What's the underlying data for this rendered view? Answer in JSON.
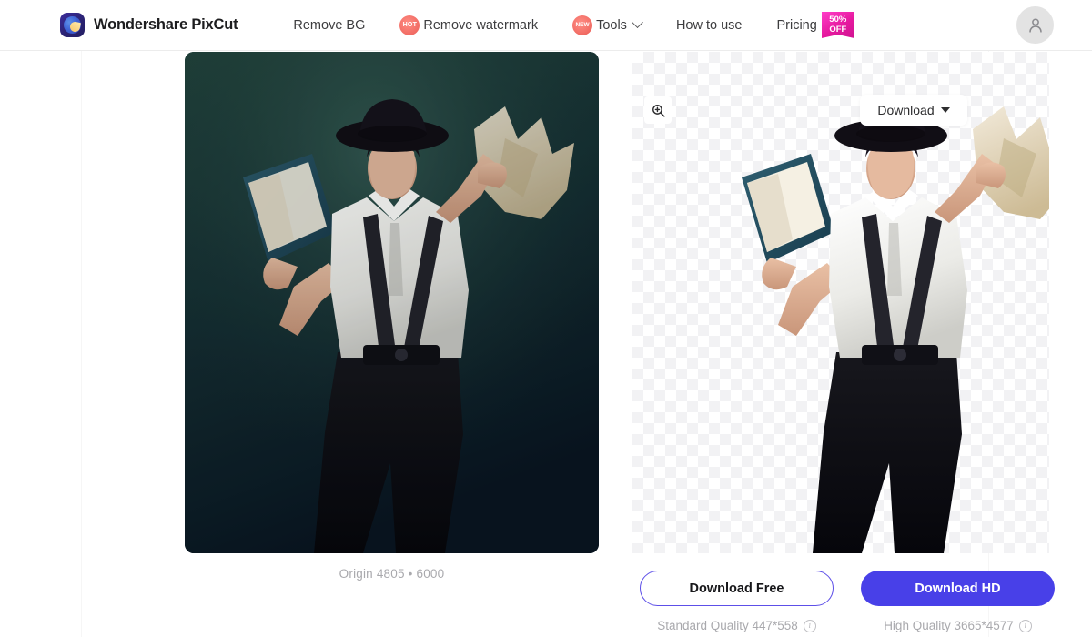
{
  "header": {
    "brand": {
      "name": "Wondershare PixCut",
      "logo_icon": "pixcut-logo-icon"
    },
    "nav": [
      {
        "label": "Remove BG",
        "badge": null,
        "has_dropdown": false
      },
      {
        "label": "Remove watermark",
        "badge": "HOT",
        "has_dropdown": false
      },
      {
        "label": "Tools",
        "badge": "NEW",
        "has_dropdown": true
      },
      {
        "label": "How to use",
        "badge": null,
        "has_dropdown": false
      }
    ],
    "pricing": {
      "label": "Pricing",
      "badge_line1": "50%",
      "badge_line2": "OFF",
      "badge_color": "#e6199f"
    },
    "avatar": {
      "icon": "user-avatar-icon"
    }
  },
  "workspace": {
    "zoom_button": {
      "icon": "zoom-in-icon"
    },
    "download_dropdown": {
      "label": "Download",
      "icon": "chevron-down-icon"
    },
    "origin": {
      "caption": "Origin 4805 • 6000"
    },
    "result": {
      "transparency": "checkerboard"
    }
  },
  "actions": {
    "free": {
      "label": "Download Free",
      "quality": "Standard Quality 447*558",
      "info_icon": "info-icon"
    },
    "hd": {
      "label": "Download HD",
      "quality": "High Quality 3665*4577",
      "info_icon": "info-icon",
      "color": "#4840e8"
    }
  }
}
